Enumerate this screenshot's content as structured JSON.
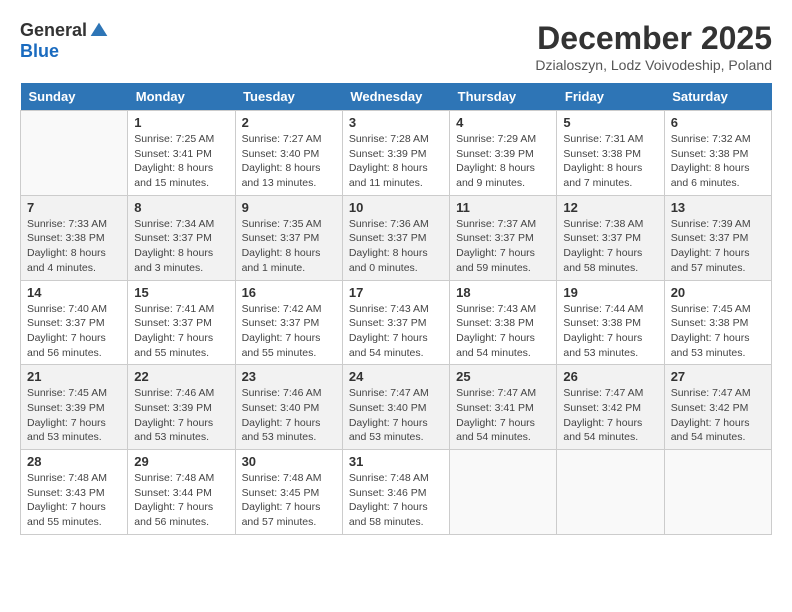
{
  "logo": {
    "general": "General",
    "blue": "Blue"
  },
  "title": "December 2025",
  "location": "Dzialoszyn, Lodz Voivodeship, Poland",
  "weekdays": [
    "Sunday",
    "Monday",
    "Tuesday",
    "Wednesday",
    "Thursday",
    "Friday",
    "Saturday"
  ],
  "weeks": [
    [
      {
        "day": "",
        "info": ""
      },
      {
        "day": "1",
        "info": "Sunrise: 7:25 AM\nSunset: 3:41 PM\nDaylight: 8 hours\nand 15 minutes."
      },
      {
        "day": "2",
        "info": "Sunrise: 7:27 AM\nSunset: 3:40 PM\nDaylight: 8 hours\nand 13 minutes."
      },
      {
        "day": "3",
        "info": "Sunrise: 7:28 AM\nSunset: 3:39 PM\nDaylight: 8 hours\nand 11 minutes."
      },
      {
        "day": "4",
        "info": "Sunrise: 7:29 AM\nSunset: 3:39 PM\nDaylight: 8 hours\nand 9 minutes."
      },
      {
        "day": "5",
        "info": "Sunrise: 7:31 AM\nSunset: 3:38 PM\nDaylight: 8 hours\nand 7 minutes."
      },
      {
        "day": "6",
        "info": "Sunrise: 7:32 AM\nSunset: 3:38 PM\nDaylight: 8 hours\nand 6 minutes."
      }
    ],
    [
      {
        "day": "7",
        "info": "Sunrise: 7:33 AM\nSunset: 3:38 PM\nDaylight: 8 hours\nand 4 minutes."
      },
      {
        "day": "8",
        "info": "Sunrise: 7:34 AM\nSunset: 3:37 PM\nDaylight: 8 hours\nand 3 minutes."
      },
      {
        "day": "9",
        "info": "Sunrise: 7:35 AM\nSunset: 3:37 PM\nDaylight: 8 hours\nand 1 minute."
      },
      {
        "day": "10",
        "info": "Sunrise: 7:36 AM\nSunset: 3:37 PM\nDaylight: 8 hours\nand 0 minutes."
      },
      {
        "day": "11",
        "info": "Sunrise: 7:37 AM\nSunset: 3:37 PM\nDaylight: 7 hours\nand 59 minutes."
      },
      {
        "day": "12",
        "info": "Sunrise: 7:38 AM\nSunset: 3:37 PM\nDaylight: 7 hours\nand 58 minutes."
      },
      {
        "day": "13",
        "info": "Sunrise: 7:39 AM\nSunset: 3:37 PM\nDaylight: 7 hours\nand 57 minutes."
      }
    ],
    [
      {
        "day": "14",
        "info": "Sunrise: 7:40 AM\nSunset: 3:37 PM\nDaylight: 7 hours\nand 56 minutes."
      },
      {
        "day": "15",
        "info": "Sunrise: 7:41 AM\nSunset: 3:37 PM\nDaylight: 7 hours\nand 55 minutes."
      },
      {
        "day": "16",
        "info": "Sunrise: 7:42 AM\nSunset: 3:37 PM\nDaylight: 7 hours\nand 55 minutes."
      },
      {
        "day": "17",
        "info": "Sunrise: 7:43 AM\nSunset: 3:37 PM\nDaylight: 7 hours\nand 54 minutes."
      },
      {
        "day": "18",
        "info": "Sunrise: 7:43 AM\nSunset: 3:38 PM\nDaylight: 7 hours\nand 54 minutes."
      },
      {
        "day": "19",
        "info": "Sunrise: 7:44 AM\nSunset: 3:38 PM\nDaylight: 7 hours\nand 53 minutes."
      },
      {
        "day": "20",
        "info": "Sunrise: 7:45 AM\nSunset: 3:38 PM\nDaylight: 7 hours\nand 53 minutes."
      }
    ],
    [
      {
        "day": "21",
        "info": "Sunrise: 7:45 AM\nSunset: 3:39 PM\nDaylight: 7 hours\nand 53 minutes."
      },
      {
        "day": "22",
        "info": "Sunrise: 7:46 AM\nSunset: 3:39 PM\nDaylight: 7 hours\nand 53 minutes."
      },
      {
        "day": "23",
        "info": "Sunrise: 7:46 AM\nSunset: 3:40 PM\nDaylight: 7 hours\nand 53 minutes."
      },
      {
        "day": "24",
        "info": "Sunrise: 7:47 AM\nSunset: 3:40 PM\nDaylight: 7 hours\nand 53 minutes."
      },
      {
        "day": "25",
        "info": "Sunrise: 7:47 AM\nSunset: 3:41 PM\nDaylight: 7 hours\nand 54 minutes."
      },
      {
        "day": "26",
        "info": "Sunrise: 7:47 AM\nSunset: 3:42 PM\nDaylight: 7 hours\nand 54 minutes."
      },
      {
        "day": "27",
        "info": "Sunrise: 7:47 AM\nSunset: 3:42 PM\nDaylight: 7 hours\nand 54 minutes."
      }
    ],
    [
      {
        "day": "28",
        "info": "Sunrise: 7:48 AM\nSunset: 3:43 PM\nDaylight: 7 hours\nand 55 minutes."
      },
      {
        "day": "29",
        "info": "Sunrise: 7:48 AM\nSunset: 3:44 PM\nDaylight: 7 hours\nand 56 minutes."
      },
      {
        "day": "30",
        "info": "Sunrise: 7:48 AM\nSunset: 3:45 PM\nDaylight: 7 hours\nand 57 minutes."
      },
      {
        "day": "31",
        "info": "Sunrise: 7:48 AM\nSunset: 3:46 PM\nDaylight: 7 hours\nand 58 minutes."
      },
      {
        "day": "",
        "info": ""
      },
      {
        "day": "",
        "info": ""
      },
      {
        "day": "",
        "info": ""
      }
    ]
  ]
}
